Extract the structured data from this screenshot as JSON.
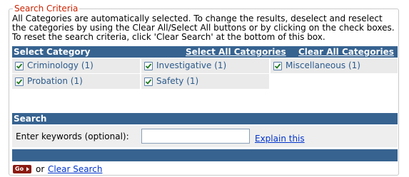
{
  "legend": "Search Criteria",
  "intro": "All Categories are automatically selected. To change the results, deselect and reselect the categories by using the Clear All/Select All buttons or by clicking on the check boxes. To reset the search criteria, click 'Clear Search' at the bottom of this box.",
  "category_bar": {
    "title": "Select Category",
    "select_all": "Select All Categories",
    "clear_all": "Clear All Categories"
  },
  "categories": [
    {
      "label": "Criminology (1)",
      "checked": true
    },
    {
      "label": "Investigative (1)",
      "checked": true
    },
    {
      "label": "Miscellaneous (1)",
      "checked": true
    },
    {
      "label": "Probation (1)",
      "checked": true
    },
    {
      "label": "Safety (1)",
      "checked": true
    }
  ],
  "search_bar": {
    "title": "Search"
  },
  "keywords": {
    "label": "Enter keywords (optional):",
    "value": "",
    "explain": "Explain this"
  },
  "footer": {
    "go_label": "Go",
    "or_text": "or",
    "clear_search": "Clear Search"
  },
  "colors": {
    "legend": "#cc2200",
    "bar": "#376390",
    "category_text": "#2b5a8c",
    "link": "#0033cc",
    "go_button": "#8a1b12"
  }
}
